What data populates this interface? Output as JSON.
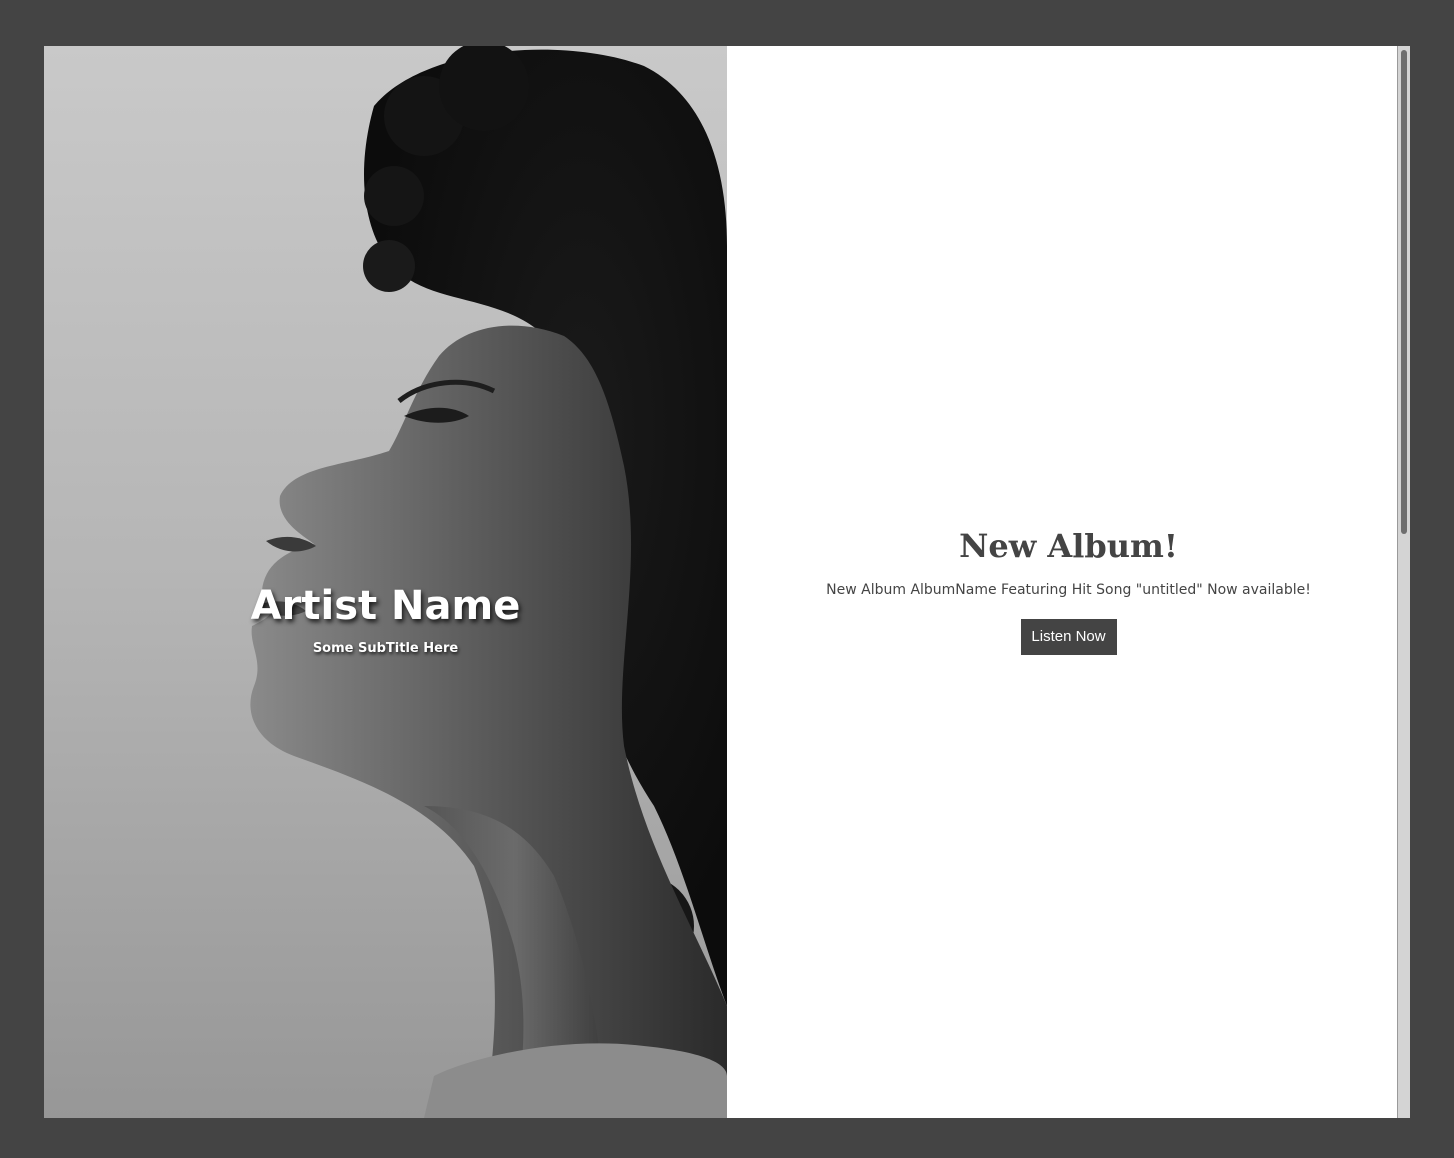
{
  "hero": {
    "artist_name": "Artist Name",
    "subtitle": "Some SubTitle Here"
  },
  "album": {
    "heading": "New Album!",
    "description": "New Album AlbumName Featuring Hit Song \"untitled\" Now available!",
    "button_label": "Listen Now"
  },
  "colors": {
    "page_background": "#444444",
    "panel_background": "#ffffff",
    "text_dark": "#444444",
    "button_background": "#444444",
    "button_text": "#ffffff",
    "hero_text": "#ffffff"
  }
}
